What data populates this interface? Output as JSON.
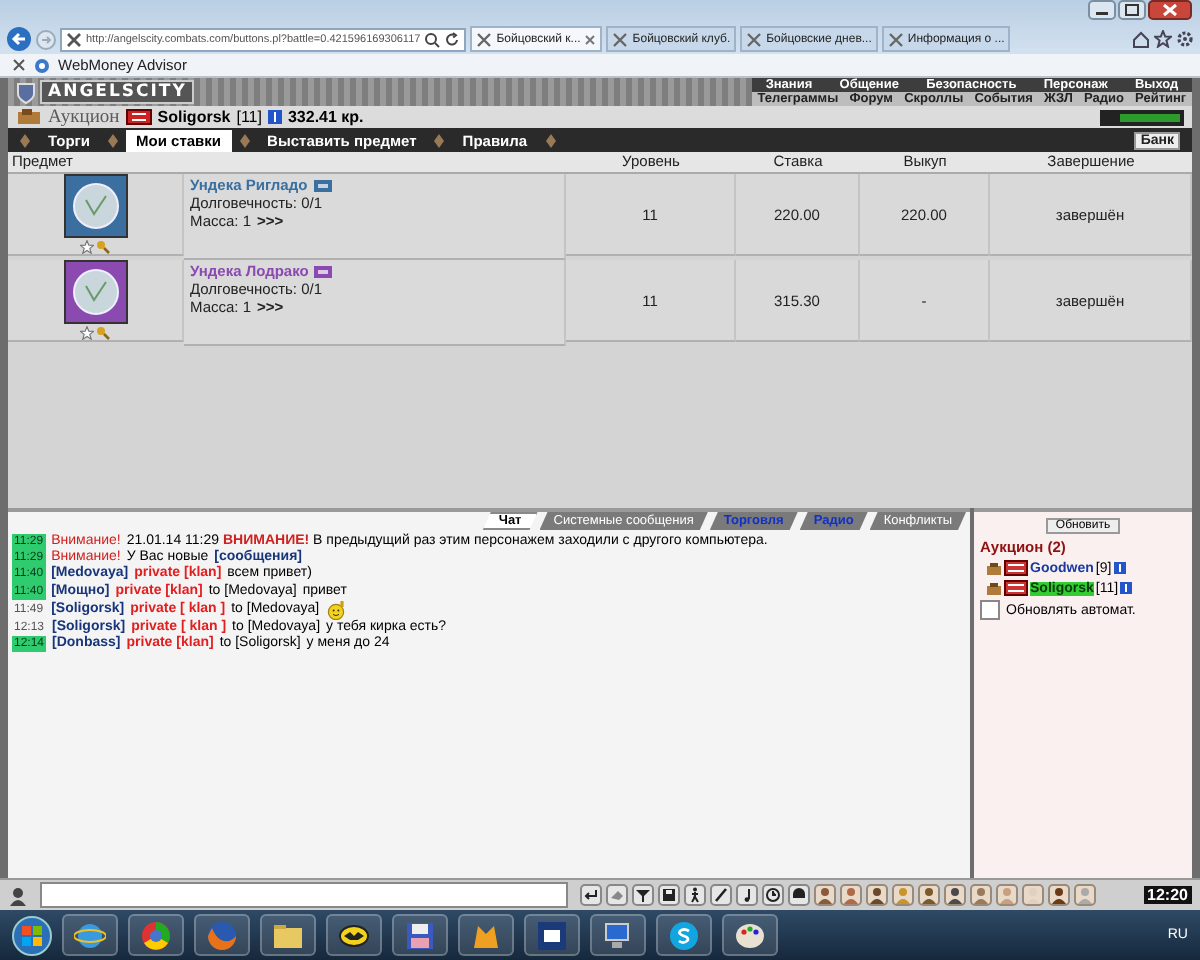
{
  "browser": {
    "address": "http://angelscity.combats.com/buttons.pl?battle=0.421596169306117",
    "tabs": [
      {
        "label": "Бойцовский к...",
        "selected": true
      },
      {
        "label": "Бойцовский клуб.",
        "selected": false
      },
      {
        "label": "Бойцовские днев...",
        "selected": false
      },
      {
        "label": "Информация о ...",
        "selected": false
      }
    ],
    "favorites": [
      "WebMoney Advisor"
    ]
  },
  "game": {
    "logo": "ANGELSCITY",
    "menu_top": [
      "Знания",
      "Общение",
      "Безопасность",
      "Персонаж",
      "Выход"
    ],
    "menu_bottom": [
      "Телеграммы",
      "Форум",
      "Скроллы",
      "События",
      "ЖЗЛ",
      "Радио",
      "Рейтинг"
    ],
    "bank": "Банк"
  },
  "auction": {
    "title": "Аукцион",
    "user": {
      "name": "Soligorsk",
      "level": "[11]"
    },
    "money": "332.41 кр.",
    "tabs": [
      {
        "label": "Торги",
        "selected": false
      },
      {
        "label": "Мои ставки",
        "selected": true
      },
      {
        "label": "Выставить предмет",
        "selected": false
      },
      {
        "label": "Правила",
        "selected": false
      }
    ]
  },
  "table": {
    "columns": [
      "Предмет",
      "Уровень",
      "Ставка",
      "Выкуп",
      "Завершение"
    ],
    "rows": [
      {
        "name": "Ундека Ригладо",
        "color": "#3a6fa0",
        "durability": "Долговечность: 0/1",
        "mass": "Масса: 1",
        "more": ">>>",
        "level": "11",
        "bid": "220.00",
        "buyout": "220.00",
        "status": "завершён"
      },
      {
        "name": "Ундека Лодрако",
        "color": "#8a4ab0",
        "durability": "Долговечность: 0/1",
        "mass": "Масса: 1",
        "more": ">>>",
        "level": "11",
        "bid": "315.30",
        "buyout": "-",
        "status": "завершён"
      }
    ]
  },
  "chat": {
    "tabs": [
      {
        "label": "Чат",
        "selected": true,
        "on": false
      },
      {
        "label": "Системные сообщения",
        "selected": false,
        "on": false
      },
      {
        "label": "Торговля",
        "selected": false,
        "on": true
      },
      {
        "label": "Радио",
        "selected": false,
        "on": true
      },
      {
        "label": "Конфликты",
        "selected": false,
        "on": false
      }
    ],
    "messages": [
      {
        "kind": "system",
        "time": "11:29",
        "highlight": true,
        "label": "Внимание!",
        "text": "21.01.14 11:29 **ВНИМАНИЕ!** В предыдущий раз этим персонажем заходили с другого компьютера."
      },
      {
        "kind": "system",
        "time": "11:29",
        "highlight": true,
        "label": "Внимание!",
        "text": "У Вас новые",
        "link": "[сообщения]"
      },
      {
        "kind": "private",
        "time": "11:40",
        "highlight": true,
        "from": "[Medovaya]",
        "channel": "private [klan]",
        "text": "всем привет)"
      },
      {
        "kind": "private",
        "time": "11:40",
        "highlight": true,
        "from": "[Мощно]",
        "channel": "private [klan]",
        "to": "to [Medovaya]",
        "text": "привет"
      },
      {
        "kind": "private",
        "time": "11:49",
        "highlight": false,
        "from": "[Soligorsk]",
        "channel": "private [ klan ]",
        "to": "to [Medovaya]",
        "smiley": true
      },
      {
        "kind": "private",
        "time": "12:13",
        "highlight": false,
        "from": "[Soligorsk]",
        "channel": "private [ klan ]",
        "to": "to [Medovaya]",
        "text": "у тебя кирка есть?"
      },
      {
        "kind": "private",
        "time": "12:14",
        "highlight": true,
        "from": "[Donbass]",
        "channel": "private [klan]",
        "to": "to [Soligorsk]",
        "text": "у меня до 24"
      }
    ]
  },
  "online": {
    "refresh": "Обновить",
    "title": "Аукцион (2)",
    "users": [
      {
        "name": "Goodwen",
        "level": "[9]",
        "selected": false
      },
      {
        "name": "Soligorsk",
        "level": "[11]",
        "selected": true
      }
    ],
    "auto_refresh": {
      "label": "Обновлять автомат.",
      "checked": false
    }
  },
  "chat_bar": {
    "clock": "12:20"
  },
  "taskbar": {
    "language": "RU"
  }
}
